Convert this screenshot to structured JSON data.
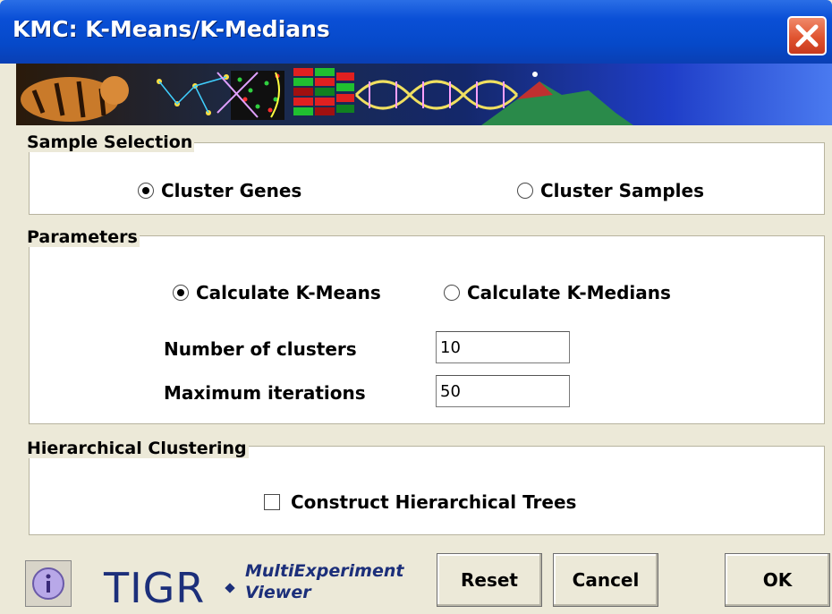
{
  "window": {
    "title": "KMC: K-Means/K-Medians"
  },
  "colors": {
    "titlebar": "#0649c9",
    "close": "#e05430",
    "brand": "#1c2f7a"
  },
  "icons": {
    "close": "close-icon",
    "info": "info-icon",
    "banner": "tigr-banner-image"
  },
  "sample_selection": {
    "title": "Sample Selection",
    "options": [
      {
        "label": "Cluster Genes",
        "selected": true
      },
      {
        "label": "Cluster Samples",
        "selected": false
      }
    ]
  },
  "parameters": {
    "title": "Parameters",
    "methods": [
      {
        "label": "Calculate K-Means",
        "selected": true
      },
      {
        "label": "Calculate K-Medians",
        "selected": false
      }
    ],
    "num_clusters": {
      "label": "Number of clusters",
      "value": "10"
    },
    "max_iterations": {
      "label": "Maximum iterations",
      "value": "50"
    }
  },
  "hierarchical": {
    "title": "Hierarchical Clustering",
    "construct_trees": {
      "label": "Construct Hierarchical Trees",
      "checked": false
    }
  },
  "footer": {
    "brand": "TIGR",
    "product_line1": "MultiExperiment",
    "product_line2": "Viewer",
    "buttons": {
      "reset": "Reset",
      "cancel": "Cancel",
      "ok": "OK"
    }
  }
}
